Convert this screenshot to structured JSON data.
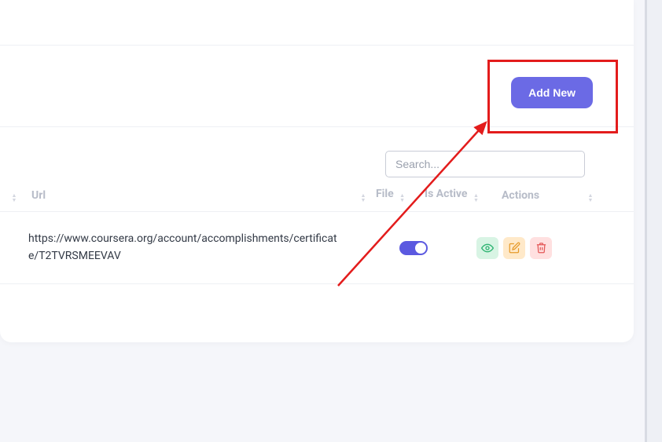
{
  "toolbar": {
    "add_new_label": "Add New"
  },
  "search": {
    "placeholder": "Search..."
  },
  "columns": {
    "url": "Url",
    "file": "File",
    "is_active": "Is Active",
    "actions": "Actions"
  },
  "rows": [
    {
      "url": "https://www.coursera.org/account/accomplishments/certificate/T2TVRSMEEVAV",
      "is_active": true
    }
  ],
  "colors": {
    "primary": "#6b6ae5",
    "annotation": "#e31c1c"
  }
}
